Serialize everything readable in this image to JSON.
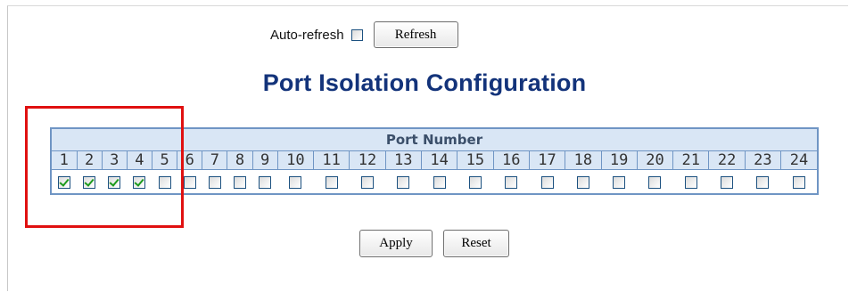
{
  "toolbar": {
    "auto_refresh_label": "Auto-refresh",
    "auto_refresh_checked": false,
    "refresh_label": "Refresh"
  },
  "page": {
    "title": "Port Isolation Configuration"
  },
  "table": {
    "header": "Port Number",
    "ports": [
      {
        "number": "1",
        "checked": true
      },
      {
        "number": "2",
        "checked": true
      },
      {
        "number": "3",
        "checked": true
      },
      {
        "number": "4",
        "checked": true
      },
      {
        "number": "5",
        "checked": false
      },
      {
        "number": "6",
        "checked": false
      },
      {
        "number": "7",
        "checked": false
      },
      {
        "number": "8",
        "checked": false
      },
      {
        "number": "9",
        "checked": false
      },
      {
        "number": "10",
        "checked": false
      },
      {
        "number": "11",
        "checked": false
      },
      {
        "number": "12",
        "checked": false
      },
      {
        "number": "13",
        "checked": false
      },
      {
        "number": "14",
        "checked": false
      },
      {
        "number": "15",
        "checked": false
      },
      {
        "number": "16",
        "checked": false
      },
      {
        "number": "17",
        "checked": false
      },
      {
        "number": "18",
        "checked": false
      },
      {
        "number": "19",
        "checked": false
      },
      {
        "number": "20",
        "checked": false
      },
      {
        "number": "21",
        "checked": false
      },
      {
        "number": "22",
        "checked": false
      },
      {
        "number": "23",
        "checked": false
      },
      {
        "number": "24",
        "checked": false
      }
    ]
  },
  "actions": {
    "apply_label": "Apply",
    "reset_label": "Reset"
  },
  "colors": {
    "title": "#13337a",
    "table_border": "#6f95c4",
    "header_bg": "#d9e6f5",
    "checkmark": "#1d9a1d",
    "highlight": "#e01010"
  }
}
